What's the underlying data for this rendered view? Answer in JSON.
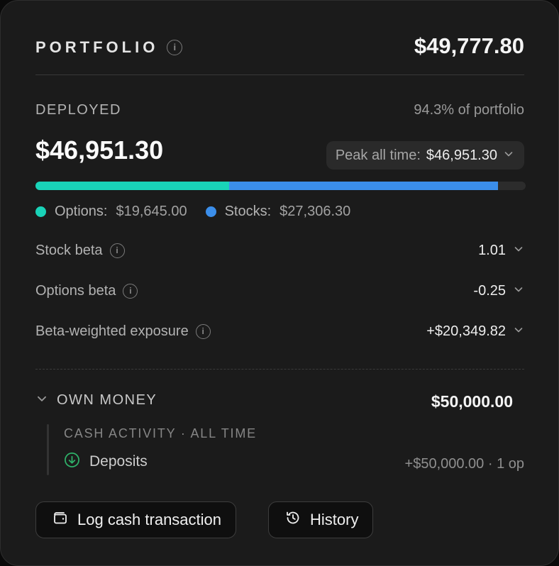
{
  "header": {
    "title": "PORTFOLIO",
    "total": "$49,777.80"
  },
  "deployed": {
    "label": "DEPLOYED",
    "percent_text": "94.3% of portfolio",
    "percent": 94.3,
    "amount": "$46,951.30",
    "peak_label": "Peak all time:",
    "peak_value": "$46,951.30"
  },
  "allocation": {
    "options": {
      "label": "Options:",
      "value": "$19,645.00",
      "amount": 19645.0,
      "color": "#19d3b8"
    },
    "stocks": {
      "label": "Stocks:",
      "value": "$27,306.30",
      "amount": 27306.3,
      "color": "#3b8eea"
    },
    "track_color": "#2c2c2c"
  },
  "metrics": [
    {
      "label": "Stock beta",
      "value": "1.01"
    },
    {
      "label": "Options beta",
      "value": "-0.25"
    },
    {
      "label": "Beta-weighted exposure",
      "value": "+$20,349.82"
    }
  ],
  "own_money": {
    "label": "OWN MONEY",
    "value": "$50,000.00",
    "cash_activity_title": "CASH ACTIVITY · ALL TIME",
    "deposits_label": "Deposits",
    "deposits_meta": "+$50,000.00 · 1 op",
    "deposit_icon_color": "#2fb36a"
  },
  "buttons": {
    "log_cash": "Log cash transaction",
    "history": "History"
  },
  "icons": {
    "info": "info-icon",
    "chevron": "chevron-down-icon",
    "deposit": "arrow-down-circle-icon",
    "wallet": "wallet-icon",
    "history": "history-icon"
  }
}
